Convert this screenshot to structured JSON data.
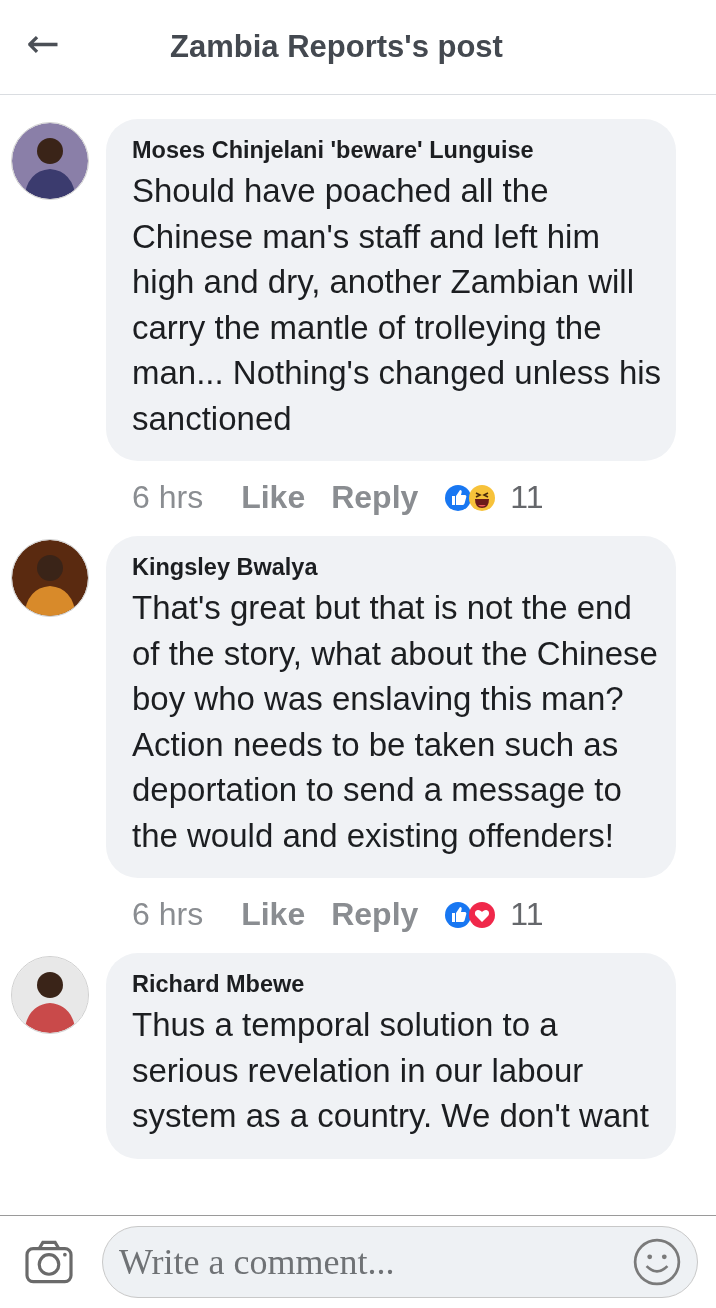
{
  "header": {
    "back_icon": "←",
    "title": "Zambia Reports's post"
  },
  "comments": [
    {
      "author": "Moses Chinjelani 'beware' Lunguise",
      "text": "Should have poached all the Chinese man's staff and left him high and dry, another Zambian will carry the mantle of trolleying the man... Nothing's changed unless his sanctioned",
      "time": "6 hrs",
      "like": "Like",
      "reply": "Reply",
      "reactions": [
        {
          "kind": "like"
        },
        {
          "kind": "haha"
        }
      ],
      "reaction_count": "11"
    },
    {
      "author": "Kingsley Bwalya",
      "text": "That's great but that is not the end of the story, what about the Chinese boy who was enslaving this man? Action needs to be taken such as deportation to send a message to the would and existing offenders!",
      "time": "6 hrs",
      "like": "Like",
      "reply": "Reply",
      "reactions": [
        {
          "kind": "like"
        },
        {
          "kind": "love"
        }
      ],
      "reaction_count": "11"
    },
    {
      "author": "Richard Mbewe",
      "text": "Thus a temporal solution to a serious revelation in our labour system as a country. We don't want"
    }
  ],
  "composer": {
    "placeholder": "Write a comment..."
  }
}
